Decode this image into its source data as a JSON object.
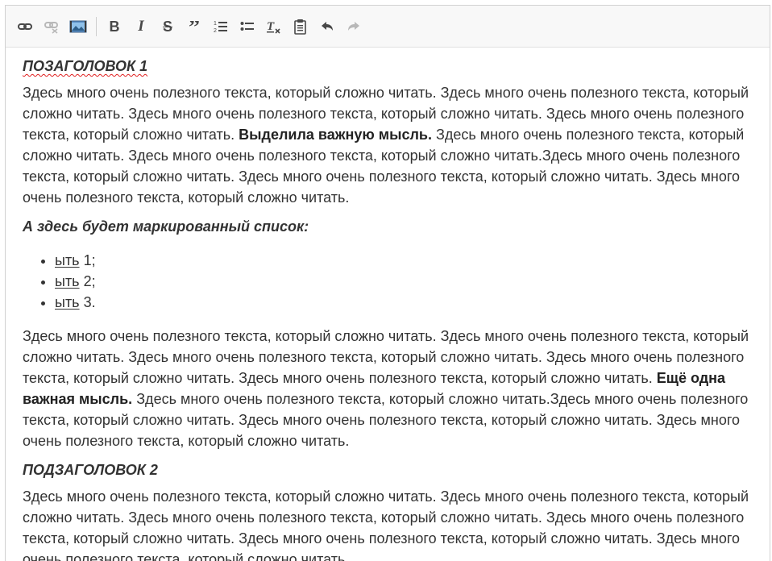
{
  "toolbar": {
    "buttons": [
      {
        "icon": "link-icon",
        "label": "Link"
      },
      {
        "icon": "unlink-icon",
        "label": "Unlink"
      },
      {
        "icon": "image-icon",
        "label": "Image"
      },
      {
        "icon": "bold-icon",
        "label": "B"
      },
      {
        "icon": "italic-icon",
        "label": "I"
      },
      {
        "icon": "strikethrough-icon",
        "label": "S"
      },
      {
        "icon": "blockquote-icon",
        "label": "Quote"
      },
      {
        "icon": "numbered-list-icon",
        "label": "Numbered list"
      },
      {
        "icon": "bulleted-list-icon",
        "label": "Bulleted list"
      },
      {
        "icon": "remove-format-icon",
        "label": "Remove format"
      },
      {
        "icon": "paste-icon",
        "label": "Paste"
      },
      {
        "icon": "undo-icon",
        "label": "Undo"
      },
      {
        "icon": "redo-icon",
        "label": "Redo"
      }
    ]
  },
  "content": {
    "heading1": "ПОЗАГОЛОВОК 1",
    "para1_part1": "Здесь много очень полезного текста, который сложно читать. Здесь много очень полезного текста, который сложно читать. Здесь много очень полезного текста, который сложно читать. Здесь много очень полезного текста, который сложно читать. ",
    "para1_bold": "Выделила важную мысль.",
    "para1_part2": " Здесь много очень полезного текста, который сложно читать. Здесь много очень полезного текста, который сложно читать.Здесь много очень полезного текста, который сложно читать. Здесь много очень полезного текста, который сложно читать. Здесь много очень полезного текста, который сложно читать.",
    "list_heading": "А здесь будет маркированный список:",
    "list_items": [
      {
        "word": "ыть",
        "rest": " 1;"
      },
      {
        "word": "ыть",
        "rest": " 2;"
      },
      {
        "word": "ыть",
        "rest": " 3."
      }
    ],
    "para2_part1": "Здесь много очень полезного текста, который сложно читать. Здесь много очень полезного текста, который сложно читать. Здесь много очень полезного текста, который сложно читать. Здесь много очень полезного текста, который сложно читать. Здесь много очень полезного текста, который сложно читать. ",
    "para2_bold": "Ещё одна важная мысль.",
    "para2_part2": " Здесь много очень полезного текста, который сложно читать.Здесь много очень полезного текста, который сложно читать. Здесь много очень полезного текста, который сложно читать. Здесь много очень полезного текста, который сложно читать.",
    "heading2": "ПОДЗАГОЛОВОК 2",
    "para3": "Здесь много очень полезного текста, который сложно читать. Здесь много очень полезного текста, который сложно читать. Здесь много очень полезного текста, который сложно читать. Здесь много очень полезного текста, который сложно читать. Здесь много очень полезного текста, который сложно читать. Здесь много очень полезного текста, который сложно читать."
  }
}
